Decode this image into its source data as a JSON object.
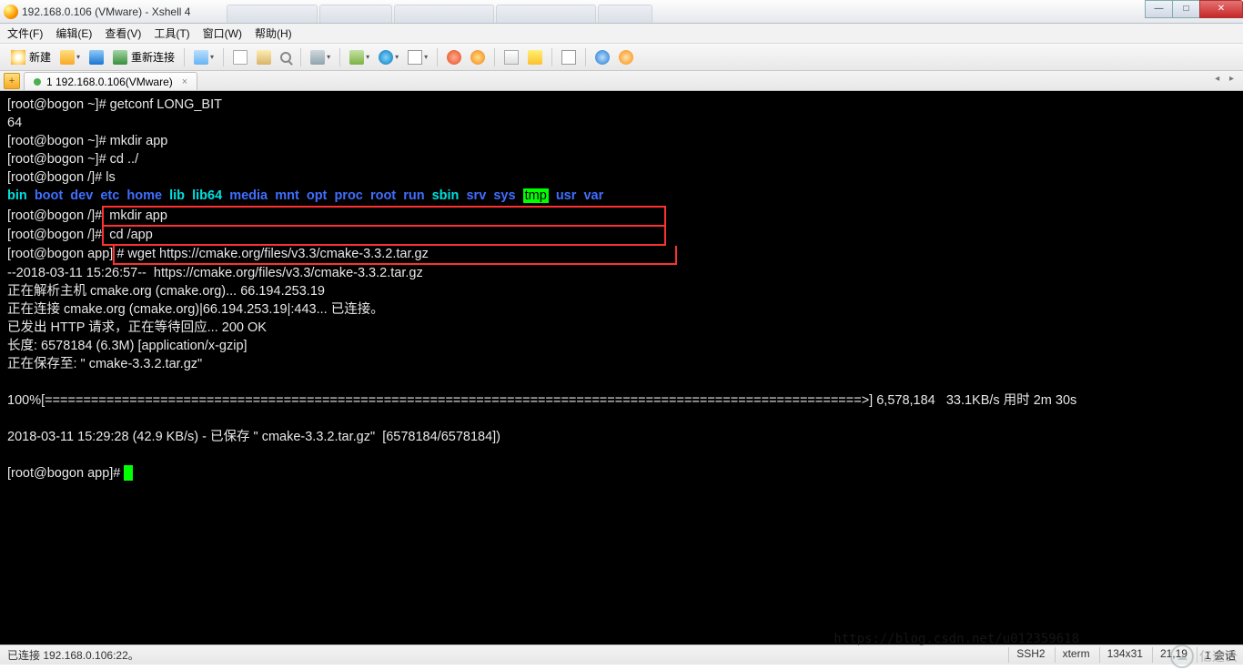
{
  "window": {
    "title": "192.168.0.106 (VMware) - Xshell 4"
  },
  "menu": {
    "file": "文件(F)",
    "edit": "编辑(E)",
    "view": "查看(V)",
    "tools": "工具(T)",
    "window": "窗口(W)",
    "help": "帮助(H)"
  },
  "toolbar": {
    "new_label": "新建",
    "reconnect_label": "重新连接"
  },
  "tab": {
    "label": "1 192.168.0.106(VMware)",
    "add": "+",
    "close": "×",
    "nav": "◂ ▸"
  },
  "terminal": {
    "line1": "[root@bogon ~]# getconf LONG_BIT",
    "line2": "64",
    "line3": "[root@bogon ~]# mkdir app",
    "line4": "[root@bogon ~]# cd ../",
    "line5": "[root@bogon /]# ls",
    "dirs": {
      "bin": "bin",
      "boot": "boot",
      "dev": "dev",
      "etc": "etc",
      "home": "home",
      "lib": "lib",
      "lib64": "lib64",
      "media": "media",
      "mnt": "mnt",
      "opt": "opt",
      "proc": "proc",
      "root": "root",
      "run": "run",
      "sbin": "sbin",
      "srv": "srv",
      "sys": "sys",
      "tmp": "tmp",
      "usr": "usr",
      "var": "var"
    },
    "prompt6": "[root@bogon /]#",
    "prompt7": "[root@bogon /]#",
    "prompt8": "[root@bogon app]",
    "box_l1": " mkdir app",
    "box_l2": " cd /app",
    "box_l3": "# wget https://cmake.org/files/v3.3/cmake-3.3.2.tar.gz",
    "line9": "--2018-03-11 15:26:57--  https://cmake.org/files/v3.3/cmake-3.3.2.tar.gz",
    "line10": "正在解析主机 cmake.org (cmake.org)... 66.194.253.19",
    "line11": "正在连接 cmake.org (cmake.org)|66.194.253.19|:443... 已连接。",
    "line12": "已发出 HTTP 请求，正在等待回应... 200 OK",
    "line13": "长度: 6578184 (6.3M) [application/x-gzip]",
    "line14": "正在保存至: \" cmake-3.3.2.tar.gz\"",
    "progress": "100%[==========================================================================================================>] 6,578,184   33.1KB/s 用时 2m 30s",
    "line16": "2018-03-11 15:29:28 (42.9 KB/s) - 已保存 \" cmake-3.3.2.tar.gz\"  [6578184/6578184])",
    "prompt_final": "[root@bogon app]# ",
    "faint_url": "https://blog.csdn.net/u012359618"
  },
  "status": {
    "left": "已连接 192.168.0.106:22。",
    "ssh": "SSH2",
    "term": "xterm",
    "size": "134x31",
    "pos": "21,19",
    "sess": "1 会话"
  },
  "watermark": {
    "brand": "亿速云"
  },
  "winbtns": {
    "min": "—",
    "max": "□",
    "close": "✕"
  }
}
